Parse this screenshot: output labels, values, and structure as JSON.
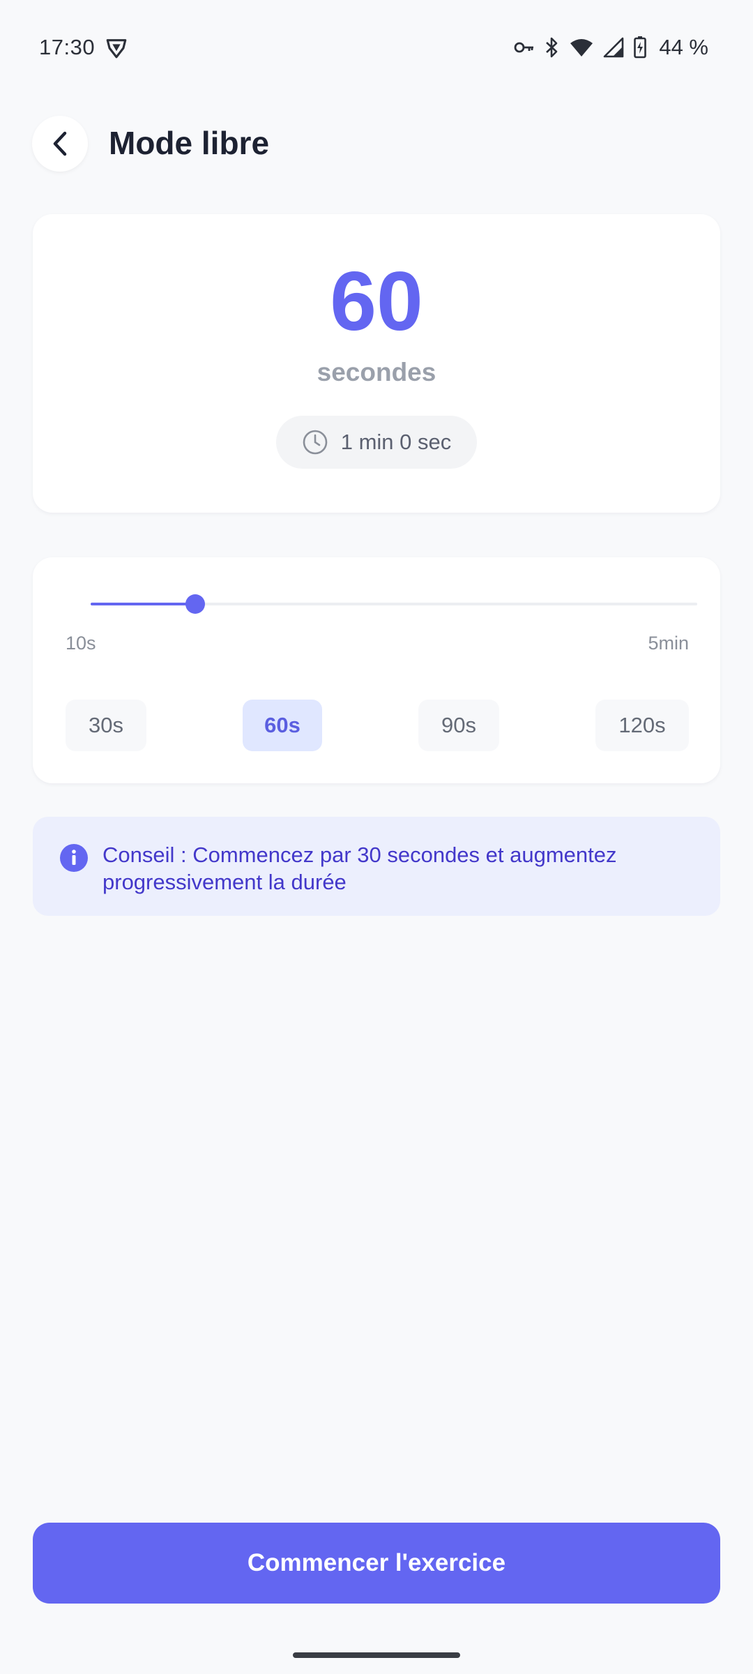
{
  "status_bar": {
    "time": "17:30",
    "battery_percent": "44 %",
    "icons": [
      "vpn-shield-icon",
      "key-icon",
      "bluetooth-icon",
      "wifi-icon",
      "cell-signal-icon",
      "battery-charging-icon"
    ]
  },
  "header": {
    "back_icon": "chevron-left-icon",
    "title": "Mode libre"
  },
  "duration": {
    "value": "60",
    "unit": "secondes",
    "formatted": "1 min 0 sec",
    "clock_icon": "clock-icon"
  },
  "slider": {
    "min_label": "10s",
    "max_label": "5min",
    "min_seconds": 10,
    "max_seconds": 300,
    "current_seconds": 60
  },
  "presets": [
    {
      "label": "30s",
      "active": false
    },
    {
      "label": "60s",
      "active": true
    },
    {
      "label": "90s",
      "active": false
    },
    {
      "label": "120s",
      "active": false
    }
  ],
  "tip": {
    "icon": "info-icon",
    "text": "Conseil : Commencez par 30 secondes et augmentez progressivement la durée"
  },
  "start_button": {
    "label": "Commencer l'exercice"
  },
  "colors": {
    "accent": "#6366f1",
    "background": "#f8f9fb",
    "tip_background": "#eceffd",
    "tip_text": "#4338ca"
  }
}
